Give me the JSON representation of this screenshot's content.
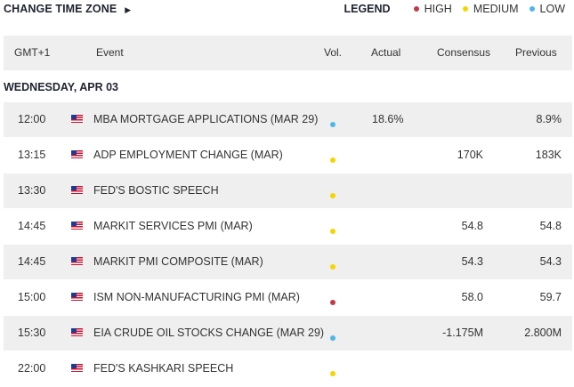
{
  "topbar": {
    "change_timezone_label": "CHANGE TIME ZONE",
    "arrow_glyph": "▶",
    "legend_title": "LEGEND",
    "legend_items": [
      {
        "label": "HIGH",
        "color": "#c0394b"
      },
      {
        "label": "MEDIUM",
        "color": "#f5d500"
      },
      {
        "label": "LOW",
        "color": "#4db8e8"
      }
    ]
  },
  "table": {
    "headers": {
      "gmt": "GMT+1",
      "event": "Event",
      "vol": "Vol.",
      "actual": "Actual",
      "consensus": "Consensus",
      "previous": "Previous"
    },
    "date_label": "WEDNESDAY, APR 03",
    "rows": [
      {
        "time": "12:00",
        "flag": "us-flag",
        "event": "MBA MORTGAGE APPLICATIONS (MAR 29)",
        "vol": "low",
        "vol_color": "#4db8e8",
        "actual": "18.6%",
        "consensus": "",
        "previous": "8.9%"
      },
      {
        "time": "13:15",
        "flag": "us-flag",
        "event": "ADP EMPLOYMENT CHANGE (MAR)",
        "vol": "medium",
        "vol_color": "#f5d500",
        "actual": "",
        "consensus": "170K",
        "previous": "183K"
      },
      {
        "time": "13:30",
        "flag": "us-flag",
        "event": "FED'S BOSTIC SPEECH",
        "vol": "medium",
        "vol_color": "#f5d500",
        "actual": "",
        "consensus": "",
        "previous": ""
      },
      {
        "time": "14:45",
        "flag": "us-flag",
        "event": "MARKIT SERVICES PMI (MAR)",
        "vol": "medium",
        "vol_color": "#f5d500",
        "actual": "",
        "consensus": "54.8",
        "previous": "54.8"
      },
      {
        "time": "14:45",
        "flag": "us-flag",
        "event": "MARKIT PMI COMPOSITE (MAR)",
        "vol": "medium",
        "vol_color": "#f5d500",
        "actual": "",
        "consensus": "54.3",
        "previous": "54.3"
      },
      {
        "time": "15:00",
        "flag": "us-flag",
        "event": "ISM NON-MANUFACTURING PMI (MAR)",
        "vol": "high",
        "vol_color": "#c0394b",
        "actual": "",
        "consensus": "58.0",
        "previous": "59.7"
      },
      {
        "time": "15:30",
        "flag": "us-flag",
        "event": "EIA CRUDE OIL STOCKS CHANGE (MAR 29)",
        "vol": "low",
        "vol_color": "#4db8e8",
        "actual": "",
        "consensus": "-1.175M",
        "previous": "2.800M"
      },
      {
        "time": "22:00",
        "flag": "us-flag",
        "event": "FED'S KASHKARI SPEECH",
        "vol": "medium",
        "vol_color": "#f5d500",
        "actual": "",
        "consensus": "",
        "previous": ""
      }
    ]
  }
}
